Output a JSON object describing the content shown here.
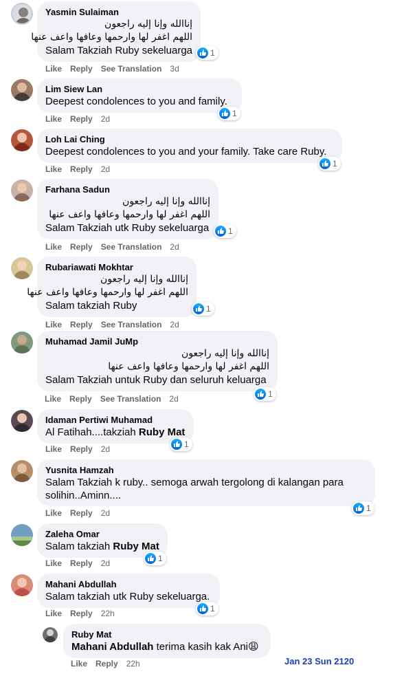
{
  "actions": {
    "like": "Like",
    "reply": "Reply",
    "see_translation": "See Translation"
  },
  "colors": {
    "bubble": "#f0f2f5",
    "like_blue": "#1877f2",
    "meta_gray": "#65676b",
    "watermark": "#1a3fb0"
  },
  "comments": [
    {
      "author": "Yasmin Sulaiman",
      "lines": [
        "إناالله وإنا إليه راجعون",
        "اللهم اغفر لها وارحمها وعافها واعف عنها",
        "Salam Takziah Ruby sekeluarga"
      ],
      "reactions": "1",
      "time": "3d",
      "translation": true
    },
    {
      "author": "Lim Siew Lan",
      "lines": [
        "Deepest condolences to you and family."
      ],
      "reactions": "1",
      "time": "2d"
    },
    {
      "author": "Loh Lai Ching",
      "lines": [
        "Deepest condolences to you and your family. Take care Ruby."
      ],
      "reactions": "1",
      "time": "2d"
    },
    {
      "author": "Farhana Sadun",
      "lines": [
        "إناالله وإنا إليه راجعون",
        "اللهم اغفر لها وارحمها وعافها واعف عنها",
        "Salam Takziah utk Ruby sekeluarga"
      ],
      "reactions": "1",
      "time": "2d",
      "translation": true
    },
    {
      "author": "Rubariawati Mokhtar",
      "lines": [
        "إناالله وإنا إليه راجعون",
        "اللهم اغفر لها وارحمها وعافها واعف عنها",
        "Salam takziah Ruby"
      ],
      "reactions": "1",
      "time": "2d",
      "translation": true
    },
    {
      "author": "Muhamad Jamil JuMp",
      "lines": [
        "إناالله وإنا إليه راجعون",
        "اللهم اغفر لها وارحمها وعافها واعف عنها",
        "Salam Takziah untuk Ruby dan seluruh keluarga"
      ],
      "reactions": "1",
      "time": "2d",
      "translation": true
    },
    {
      "author": "Idaman Pertiwi Muhamad",
      "line_prefix": "Al Fatihah....takziah ",
      "mention": "Ruby Mat",
      "reactions": "1",
      "time": "2d"
    },
    {
      "author": "Yusnita Hamzah",
      "lines": [
        "Salam Takziah k ruby.. semoga arwah tergolong di kalangan para",
        "solihin..Aminn...."
      ],
      "reactions": "1",
      "time": "2d"
    },
    {
      "author": "Zaleha Omar",
      "line_prefix": "Salam takziah ",
      "mention": "Ruby Mat",
      "reactions": "1",
      "time": "2d"
    },
    {
      "author": "Mahani Abdullah",
      "lines": [
        "Salam takziah utk Ruby sekeluarga."
      ],
      "reactions": "1",
      "time": "22h"
    }
  ],
  "reply": {
    "author": "Ruby Mat",
    "mention": "Mahani Abdullah",
    "text": " terima kasih kak Ani",
    "emoji": "😩",
    "time": "22h"
  },
  "watermark": "Jan 23 Sun 2120"
}
